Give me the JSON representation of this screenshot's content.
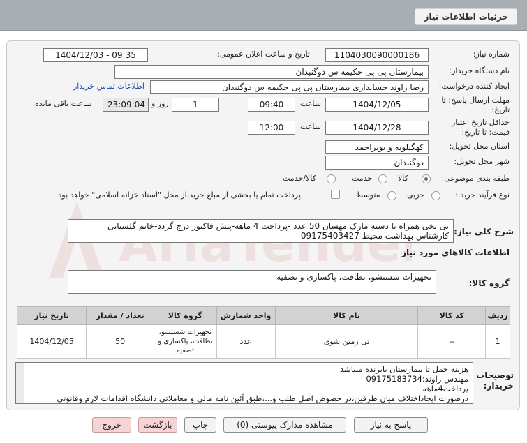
{
  "header": {
    "title": "جزئیات اطلاعات نیاز"
  },
  "form": {
    "need_number_label": "شماره نیاز:",
    "need_number": "1104030090000186",
    "announce_label": "تاریخ و ساعت اعلان عمومی:",
    "announce_value": "1404/12/03 - 09:35",
    "buyer_org_label": "نام دستگاه خریدار:",
    "buyer_org": "بیمارستان پی پی حکیمه س  دوگنبدان",
    "creator_label": "ایجاد کننده درخواست:",
    "creator": "رضا راوند حسابداری بیمارستان پی پی حکیمه س  دوگنبدان",
    "contact_link": "اطلاعات تماس خریدار",
    "send_deadline_label": "مهلت ارسال پاسخ: تا تاریخ:",
    "send_date": "1404/12/05",
    "time_label": "ساعت",
    "send_time": "09:40",
    "days_value": "1",
    "days_label": "روز و",
    "remaining": "23:09:04",
    "remaining_label": "ساعت باقی مانده",
    "validity_label": "حداقل تاریخ اعتبار قیمت: تا تاریخ:",
    "validity_date": "1404/12/28",
    "validity_time": "12:00",
    "province_label": "استان محل تحویل:",
    "province": "کهگیلویه و بویراحمد",
    "city_label": "شهر محل تحویل:",
    "city": "دوگنبدان",
    "category_label": "طبقه بندی موضوعی:",
    "category_options": [
      "کالا",
      "خدمت",
      "کالا/خدمت"
    ],
    "category_selected": "کالا",
    "process_label": "نوع فرآیند خرید :",
    "process_options": [
      "جزیی",
      "متوسط"
    ],
    "payment_note": "پرداخت تمام یا بخشی از مبلغ خرید،از محل \"اسناد خزانه اسلامی\" خواهد بود.",
    "summary_label": "شرح کلی نیاز:",
    "summary_text": "تی نخی همراه با دسته مارک مهسان 50 عدد -پرداخت 4 ماهه-پیش فاکتور درج گردد-خانم گلستانی کارشناس بهداشت محیط 09175403427",
    "goods_info_title": "اطلاعات کالاهای مورد نیاز",
    "goods_group_label": "گروه کالا:",
    "goods_group": "تجهیزات شستشو، نظافت، پاکسازی و تصفیه"
  },
  "table": {
    "headers": [
      "ردیف",
      "کد کالا",
      "نام کالا",
      "واحد شمارش",
      "تعداد / مقدار",
      "تاریخ نیاز"
    ],
    "rows": [
      {
        "row": "1",
        "code": "--",
        "name": "تی زمین شوی",
        "unit": "عدد",
        "qty": "50",
        "group": "تجهیزات شستشو، نظافت، پاکسازی و تصفیه",
        "date": "1404/12/05"
      }
    ],
    "group_header": "گروه کالا"
  },
  "buyer_notes": {
    "label": "توضیحات خریدار:",
    "lines": [
      "هزینه حمل تا بیمارستان بابرنده میباشد",
      "مهندس راوند:09175183734",
      "پرداخت4ماهه",
      "درصورت ایجاداختلاف میان طرفین،در خصوص اصل طلب و...،طبق آئین نامه مالی و معاملاتی دانشگاه اقدامات لازم وقانونی"
    ]
  },
  "buttons": {
    "reply": "پاسخ به نیاز",
    "attachments": "مشاهده مدارک پیوستی (0)",
    "print": "چاپ",
    "back": "بازگشت",
    "exit": "خروج"
  },
  "watermark": "AriaTender.neT",
  "colors": {
    "header_bg": "#a9aeb3",
    "panel_bg": "#f4f4f4",
    "link": "#1a4fb5",
    "danger_btn": "#f7d4d4"
  }
}
